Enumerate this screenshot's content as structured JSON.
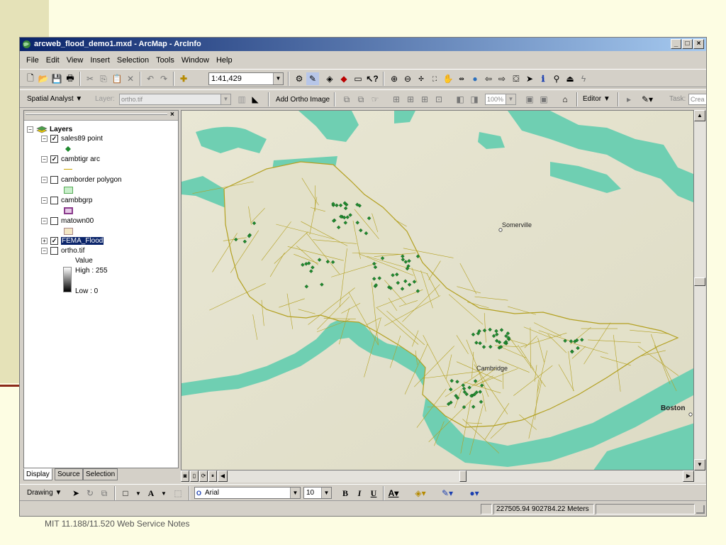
{
  "window": {
    "title": "arcweb_flood_demo1.mxd - ArcMap - ArcInfo",
    "min_label": "_",
    "max_label": "□",
    "close_label": "×"
  },
  "menu": [
    "File",
    "Edit",
    "View",
    "Insert",
    "Selection",
    "Tools",
    "Window",
    "Help"
  ],
  "toolbar": {
    "scale_value": "1:41,429"
  },
  "spatial_analyst": {
    "label": "Spatial Analyst ▼",
    "layer_label": "Layer:",
    "layer_value": "ortho.tif",
    "add_ortho_label": "Add Ortho Image",
    "zoom_value": "100%",
    "editor_label": "Editor ▼",
    "task_label": "Task:",
    "task_value": "Crea"
  },
  "toc": {
    "root_label": "Layers",
    "layers": [
      {
        "name": "sales89 point",
        "checked": "✓",
        "expand": "−"
      },
      {
        "name": "cambtigr arc",
        "checked": "✓",
        "expand": "−"
      },
      {
        "name": "camborder polygon",
        "checked": "",
        "expand": "−"
      },
      {
        "name": "cambbgrp",
        "checked": "",
        "expand": "−"
      },
      {
        "name": "matown00",
        "checked": "",
        "expand": "−"
      },
      {
        "name": "FEMA_Flood",
        "checked": "✓",
        "expand": "+"
      },
      {
        "name": "ortho.tif",
        "checked": "",
        "expand": "−"
      }
    ],
    "raster_value_label": "Value",
    "raster_high": "High : 255",
    "raster_low": "Low : 0",
    "tabs": [
      "Display",
      "Source",
      "Selection"
    ]
  },
  "map": {
    "labels": [
      "Somerville",
      "Cambridge",
      "Boston"
    ],
    "colors": {
      "water": "#6fcfb2",
      "street": "#b3a020",
      "point": "#1f8a2e",
      "terrain": "#e8e6d2"
    }
  },
  "drawing": {
    "label": "Drawing ▼",
    "font_name": "Arial",
    "font_size": "10",
    "bold": "B",
    "italic": "I",
    "underline": "U"
  },
  "status": {
    "coords": "227505.94  902784.22 Meters"
  },
  "footer": "MIT 11.188/11.520 Web Service Notes"
}
